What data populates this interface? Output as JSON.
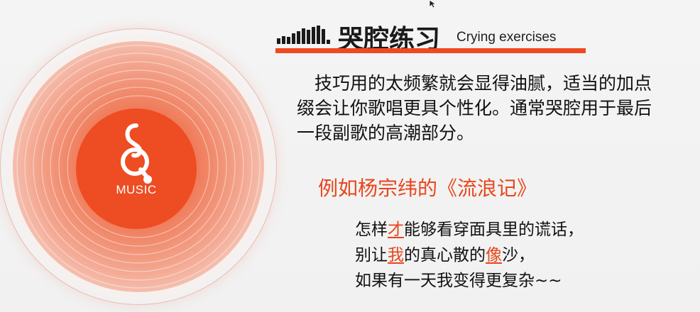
{
  "disc": {
    "label_text": "MUSIC",
    "icon": "music-note-logo-icon",
    "colors": {
      "label": "#ee4c22",
      "disc_center": "#ef6a45",
      "disc_edge": "#fbeae4"
    }
  },
  "header": {
    "icon": "audio-bars-icon",
    "title_zh": "哭腔练习",
    "title_en": "Crying exercises",
    "accent": "#ee4a20"
  },
  "paragraph": {
    "line1": "技巧用的太频繁就会显得油腻，适当的加点",
    "line2": "缀会让你歌唱更具个性化。通常哭腔用于最后",
    "line3": "一段副歌的高潮部分。"
  },
  "example": {
    "text": "例如杨宗纬的《流浪记》",
    "color": "#e8461c"
  },
  "lyrics": {
    "line1": {
      "a": "怎样",
      "hl": "才",
      "b": "能够看穿面具里的谎话，"
    },
    "line2": {
      "a": "别让",
      "hl1": "我",
      "b": "的真心散的",
      "hl2": "像",
      "c": "沙，"
    },
    "line3": "如果有一天我变得更复杂~~",
    "highlight_color": "#e8461c"
  }
}
